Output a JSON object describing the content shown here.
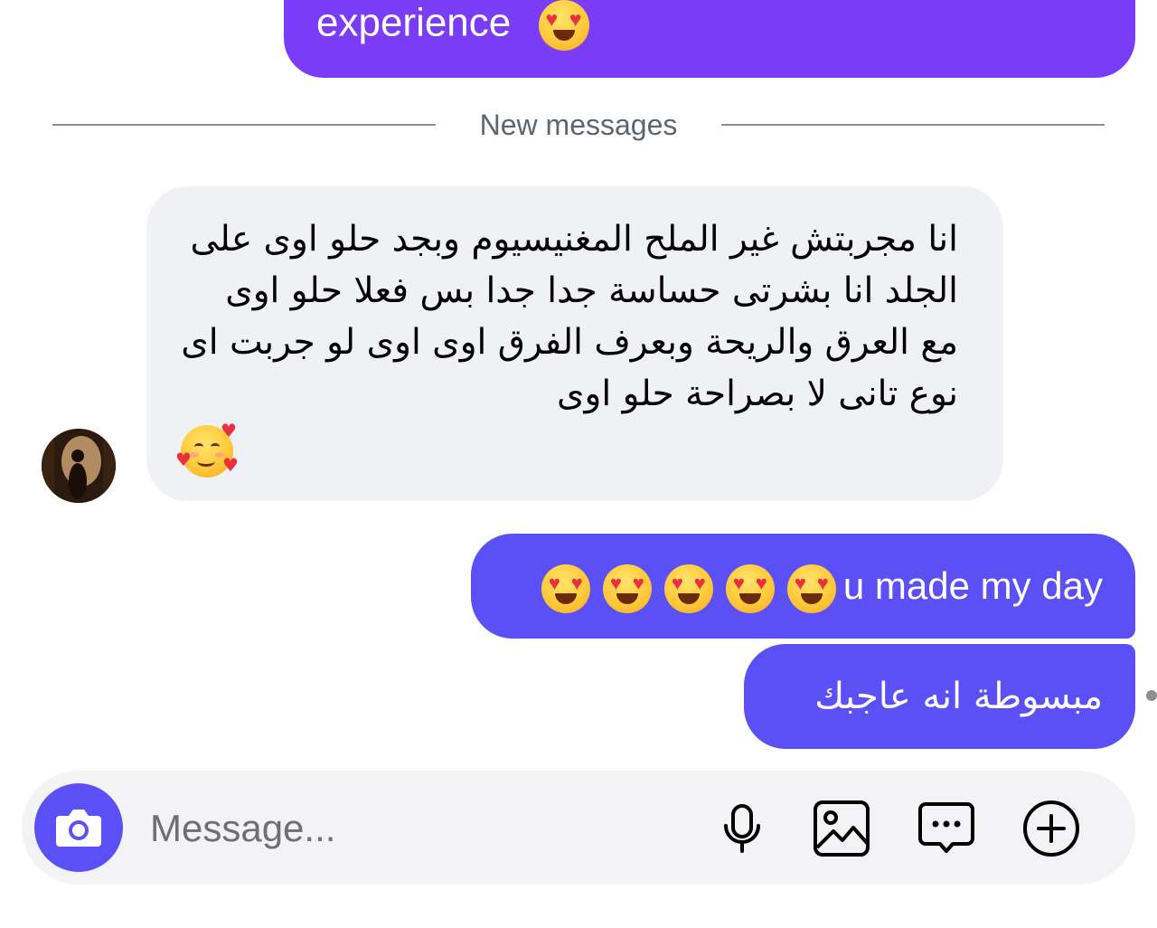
{
  "conversation": {
    "previous_outgoing": {
      "text": "experience",
      "emoji": "heart-eyes"
    },
    "divider_label": "New messages",
    "incoming_message": {
      "avatar": "contact-avatar",
      "text": "انا مجربتش غير الملح المغنيسيوم وبجد حلو اوى على الجلد انا بشرتى حساسة جدا جدا بس فعلا حلو اوى مع العرق والريحة وبعرف الفرق اوى اوى لو جربت اى نوع تانى لا بصراحة حلو اوى",
      "emoji": "smiling-face-with-hearts"
    },
    "outgoing_messages": [
      {
        "text": "u made my day",
        "emoji": "heart-eyes",
        "emoji_count": 5
      },
      {
        "text": "مبسوطة انه عاجبك"
      }
    ]
  },
  "composer": {
    "placeholder": "Message...",
    "camera_icon": "camera-icon",
    "tools": [
      "microphone-icon",
      "image-icon",
      "sticker-chat-icon",
      "plus-icon"
    ]
  },
  "colors": {
    "outgoing_top": "#7a3cf6",
    "outgoing": "#5b50f5",
    "incoming": "#eff1f4",
    "composer_bg": "#f3f3f5"
  }
}
